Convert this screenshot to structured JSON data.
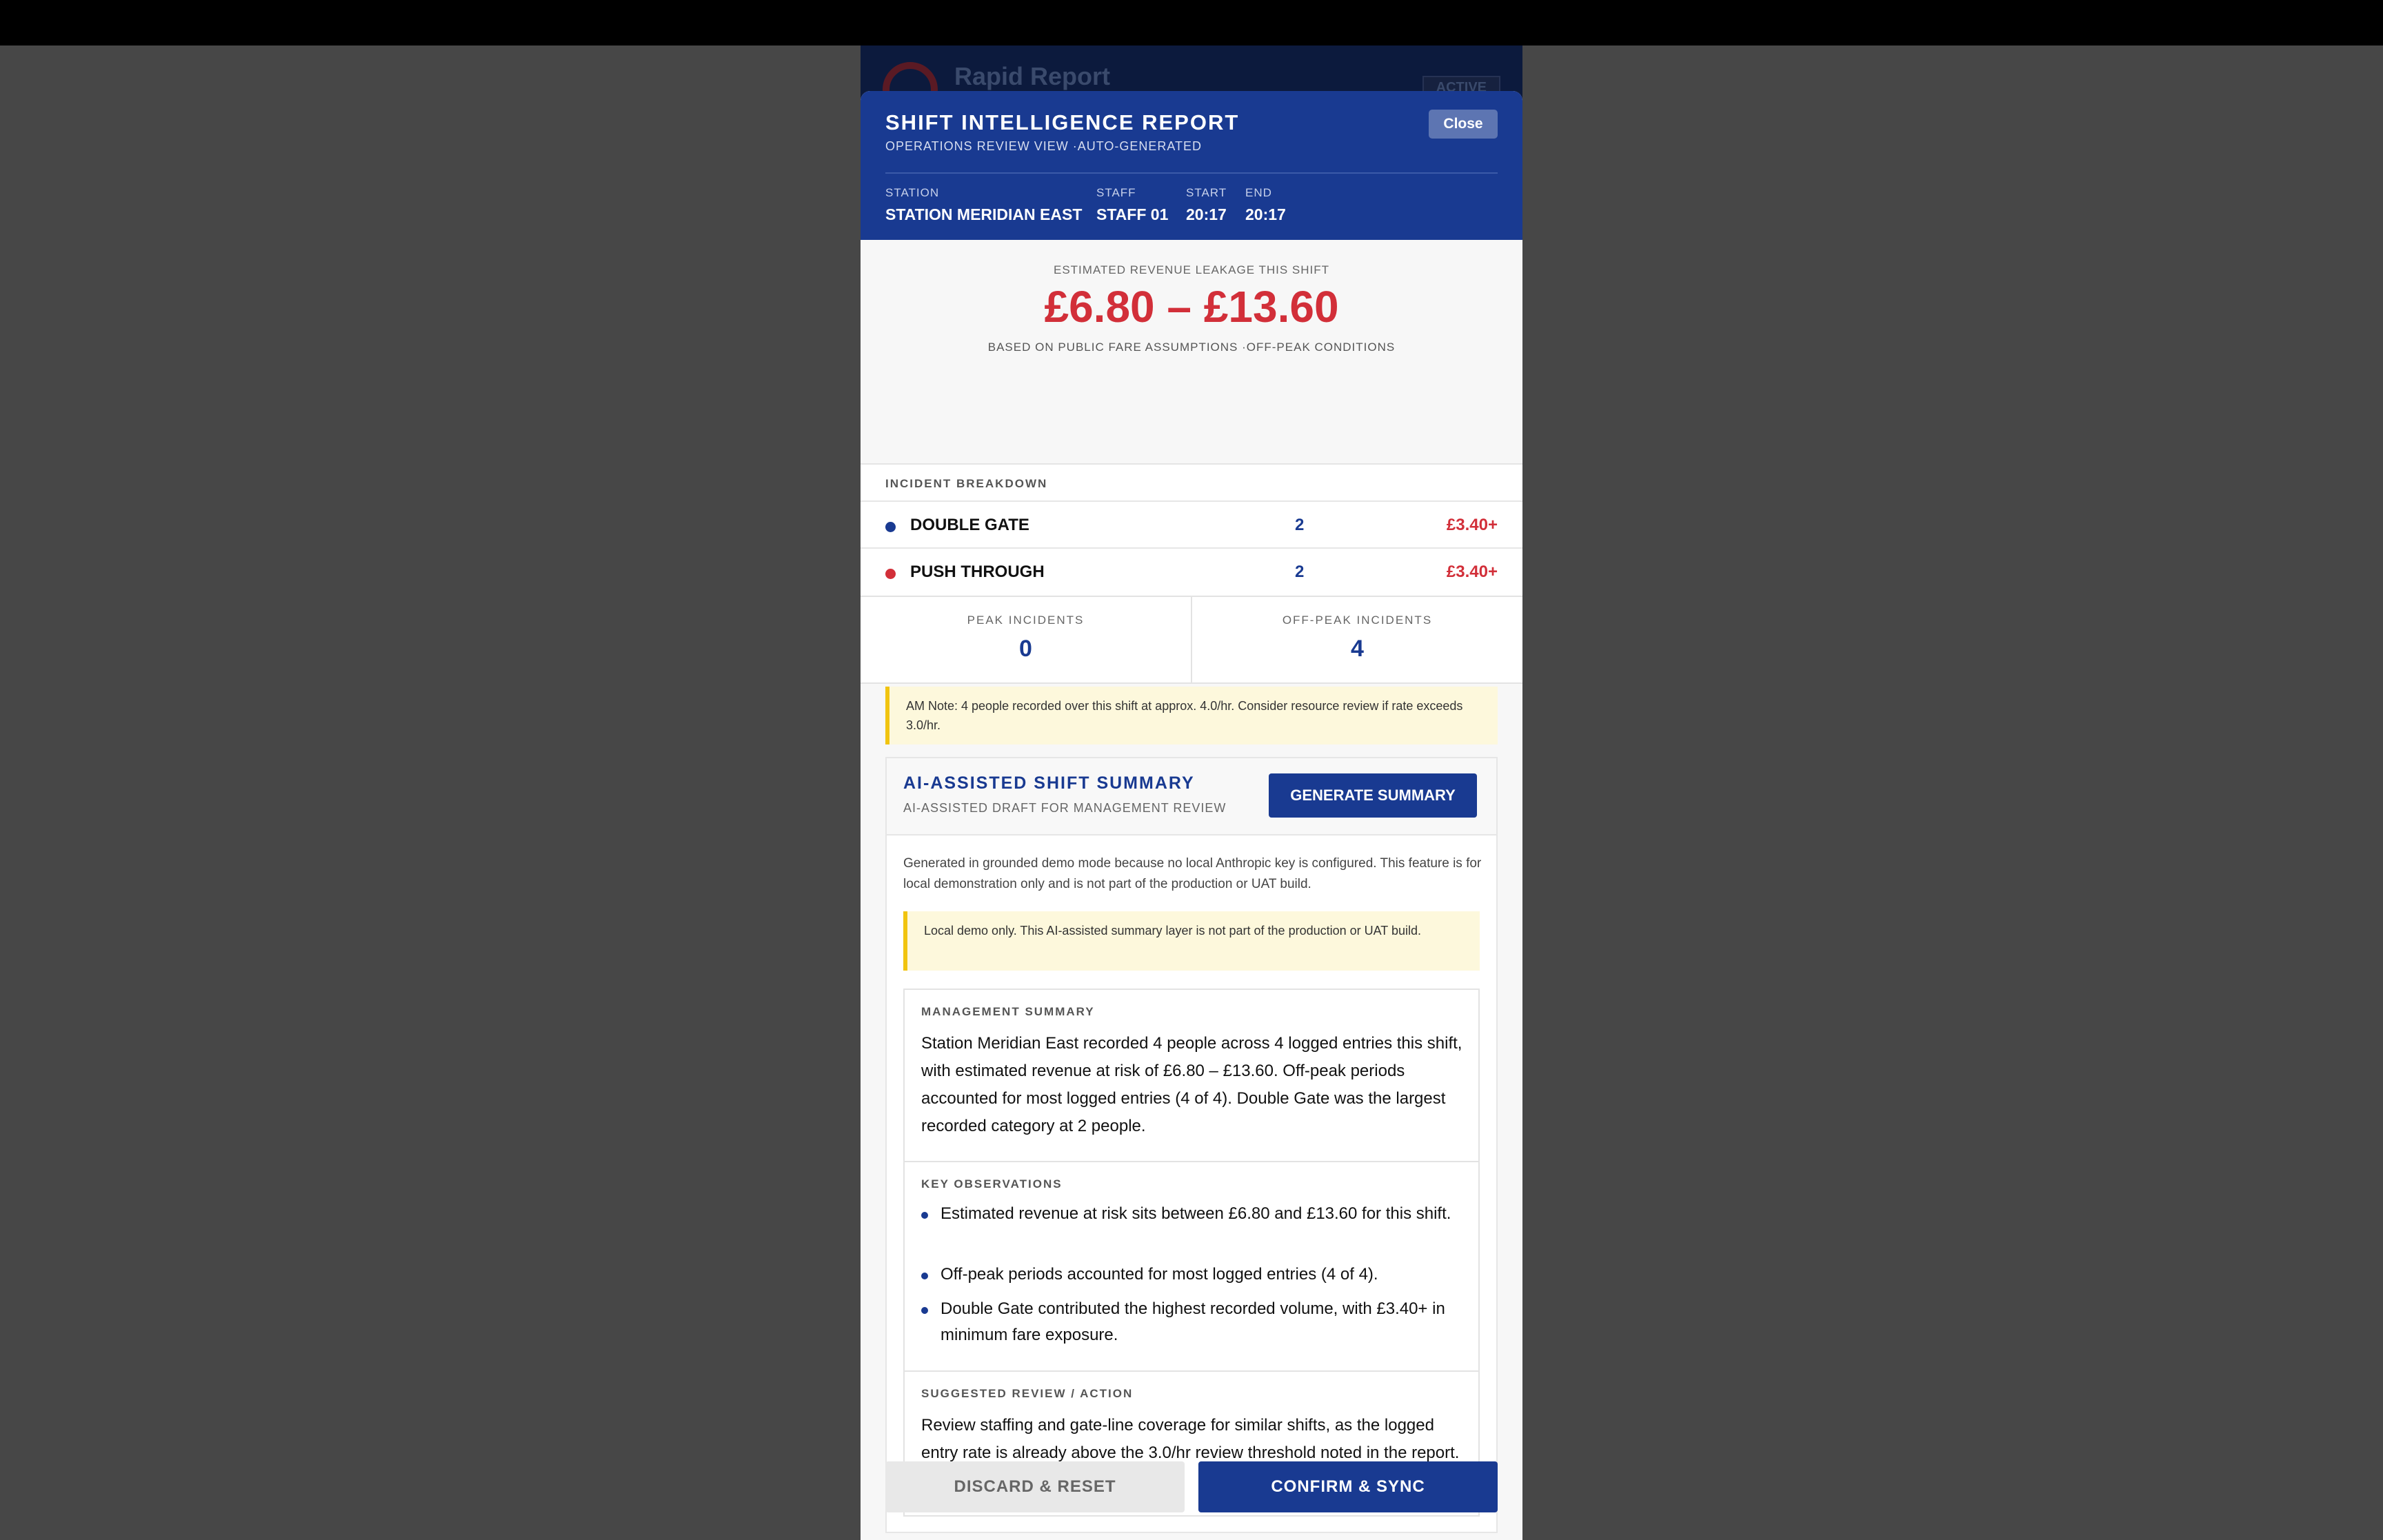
{
  "background_app": {
    "title": "Rapid Report",
    "badge": "ACTIVE"
  },
  "modal": {
    "title": "SHIFT INTELLIGENCE REPORT",
    "subtitle": "OPERATIONS REVIEW VIEW ·AUTO-GENERATED",
    "close_label": "Close",
    "meta": {
      "station_label": "STATION",
      "station_value": "STATION MERIDIAN EAST",
      "staff_label": "STAFF",
      "staff_value": "STAFF 01",
      "start_label": "START",
      "start_value": "20:17",
      "end_label": "END",
      "end_value": "20:17"
    }
  },
  "leakage": {
    "label": "ESTIMATED REVENUE LEAKAGE THIS SHIFT",
    "value": "£6.80 – £13.60",
    "basis": "BASED ON PUBLIC FARE ASSUMPTIONS ·OFF-PEAK CONDITIONS"
  },
  "breakdown": {
    "header": "INCIDENT BREAKDOWN",
    "rows": [
      {
        "name": "DOUBLE GATE",
        "count": "2",
        "amount": "£3.40+",
        "dot_color": "#193a91"
      },
      {
        "name": "PUSH THROUGH",
        "count": "2",
        "amount": "£3.40+",
        "dot_color": "#d22f39"
      }
    ]
  },
  "stats": {
    "peak_label": "PEAK INCIDENTS",
    "peak_value": "0",
    "offpeak_label": "OFF-PEAK INCIDENTS",
    "offpeak_value": "4"
  },
  "am_note": "AM Note: 4 people recorded over this shift at approx. 4.0/hr. Consider resource review if rate exceeds 3.0/hr.",
  "ai_summary": {
    "title": "AI-ASSISTED SHIFT SUMMARY",
    "subtitle": "AI-ASSISTED DRAFT FOR MANAGEMENT REVIEW",
    "generate_label": "GENERATE SUMMARY",
    "description": "Generated in grounded demo mode because no local Anthropic key is configured. This feature is for local demonstration only and is not part of the production or UAT build.",
    "demo_note": "Local demo only. This AI-assisted summary layer is not part of the production or UAT build.",
    "management_label": "MANAGEMENT SUMMARY",
    "management_text": "Station Meridian East recorded 4 people across 4 logged entries this shift, with estimated revenue at risk of £6.80 – £13.60. Off-peak periods accounted for most logged entries (4 of 4). Double Gate was the largest recorded category at 2 people.",
    "observations_label": "KEY OBSERVATIONS",
    "observations": [
      "Estimated revenue at risk sits between £6.80 and £13.60 for this shift.",
      "Off-peak periods accounted for most logged entries (4 of 4).",
      "Double Gate contributed the highest recorded volume, with £3.40+ in minimum fare exposure."
    ],
    "action_label": "SUGGESTED REVIEW / ACTION",
    "action_text": "Review staffing and gate-line coverage for similar shifts, as the logged entry rate is already above the 3.0/hr review threshold noted in the report."
  },
  "footer": {
    "discard_label": "DISCARD & RESET",
    "confirm_label": "CONFIRM & SYNC"
  },
  "colors": {
    "brand_blue": "#193a91",
    "alert_red": "#d22f39",
    "note_yellow": "#fdf8dc"
  }
}
